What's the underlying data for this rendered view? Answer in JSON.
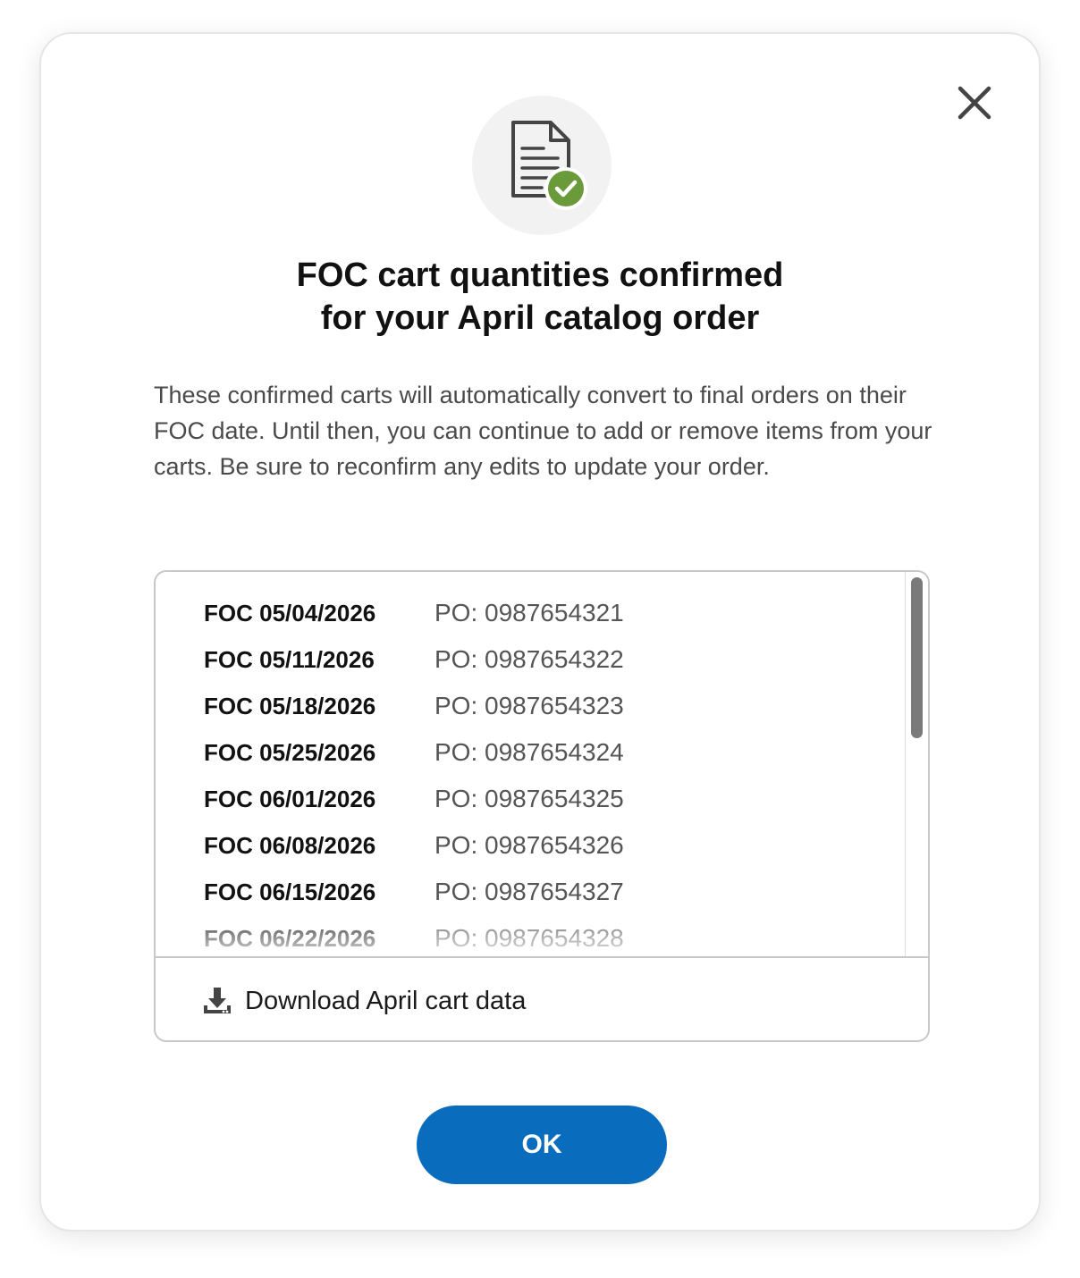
{
  "modal": {
    "title_line1": "FOC cart quantities confirmed",
    "title_line2": "for your April catalog order",
    "description": "These confirmed carts will automatically convert to final orders on their FOC date. Until then, you can continue to add or remove items from your carts. Be sure to reconfirm any edits to update your order.",
    "close_icon": "close-icon",
    "hero_icon": "document-check-icon",
    "accent_color": "#0a6cbd",
    "success_color": "#6b9a3a"
  },
  "carts": [
    {
      "foc": "FOC 05/04/2026",
      "po_label": "PO:",
      "po_number": "0987654321"
    },
    {
      "foc": "FOC 05/11/2026",
      "po_label": "PO:",
      "po_number": "0987654322"
    },
    {
      "foc": "FOC 05/18/2026",
      "po_label": "PO:",
      "po_number": "0987654323"
    },
    {
      "foc": "FOC 05/25/2026",
      "po_label": "PO:",
      "po_number": "0987654324"
    },
    {
      "foc": "FOC 06/01/2026",
      "po_label": "PO:",
      "po_number": "0987654325"
    },
    {
      "foc": "FOC 06/08/2026",
      "po_label": "PO:",
      "po_number": "0987654326"
    },
    {
      "foc": "FOC 06/15/2026",
      "po_label": "PO:",
      "po_number": "0987654327"
    },
    {
      "foc": "FOC 06/22/2026",
      "po_label": "PO:",
      "po_number": "0987654328"
    }
  ],
  "download": {
    "label": "Download April cart data",
    "icon": "download-icon"
  },
  "ok_button": {
    "label": "OK"
  }
}
